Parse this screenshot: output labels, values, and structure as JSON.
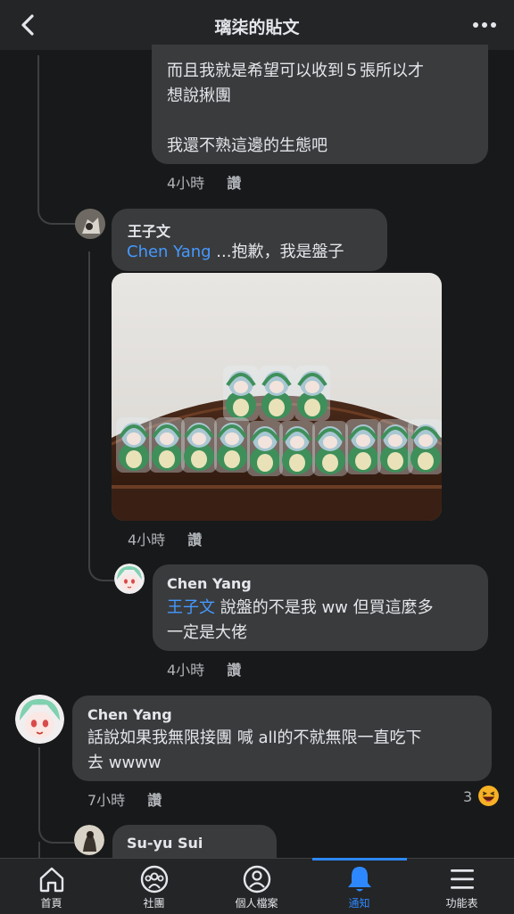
{
  "header": {
    "title": "璃柒的貼文"
  },
  "comments": [
    {
      "lines": [
        "而且我就是希望可以收到５張所以才",
        "想說揪團",
        "",
        "我還不熟這邊的生態吧"
      ],
      "time": "4小時",
      "like": "讚"
    },
    {
      "author": "王子文",
      "mention": "Chen Yang",
      "text": " ...抱歉，我是盤子",
      "time": "4小時",
      "like": "讚"
    },
    {
      "author": "Chen Yang",
      "mention": "王子文",
      "text_line1": " 說盤的不是我 ww 但買這麼多",
      "text_line2": "一定是大佬",
      "time": "4小時",
      "like": "讚"
    },
    {
      "author": "Chen Yang",
      "line1": "話說如果我無限接團 喊 all的不就無限一直吃下",
      "line2": "去 wwww",
      "time": "7小時",
      "like": "讚",
      "reaction_count": "3"
    },
    {
      "author": "Su-yu Sui"
    }
  ],
  "nav": {
    "items": [
      {
        "label": "首頁",
        "icon": "home-icon"
      },
      {
        "label": "社團",
        "icon": "groups-icon"
      },
      {
        "label": "個人檔案",
        "icon": "profile-icon"
      },
      {
        "label": "通知",
        "icon": "bell-icon",
        "active": true
      },
      {
        "label": "功能表",
        "icon": "menu-icon"
      }
    ]
  },
  "colors": {
    "accent": "#2d88ff",
    "mention": "#4599ff",
    "bubble": "#3a3b3c",
    "background": "#18191a"
  }
}
